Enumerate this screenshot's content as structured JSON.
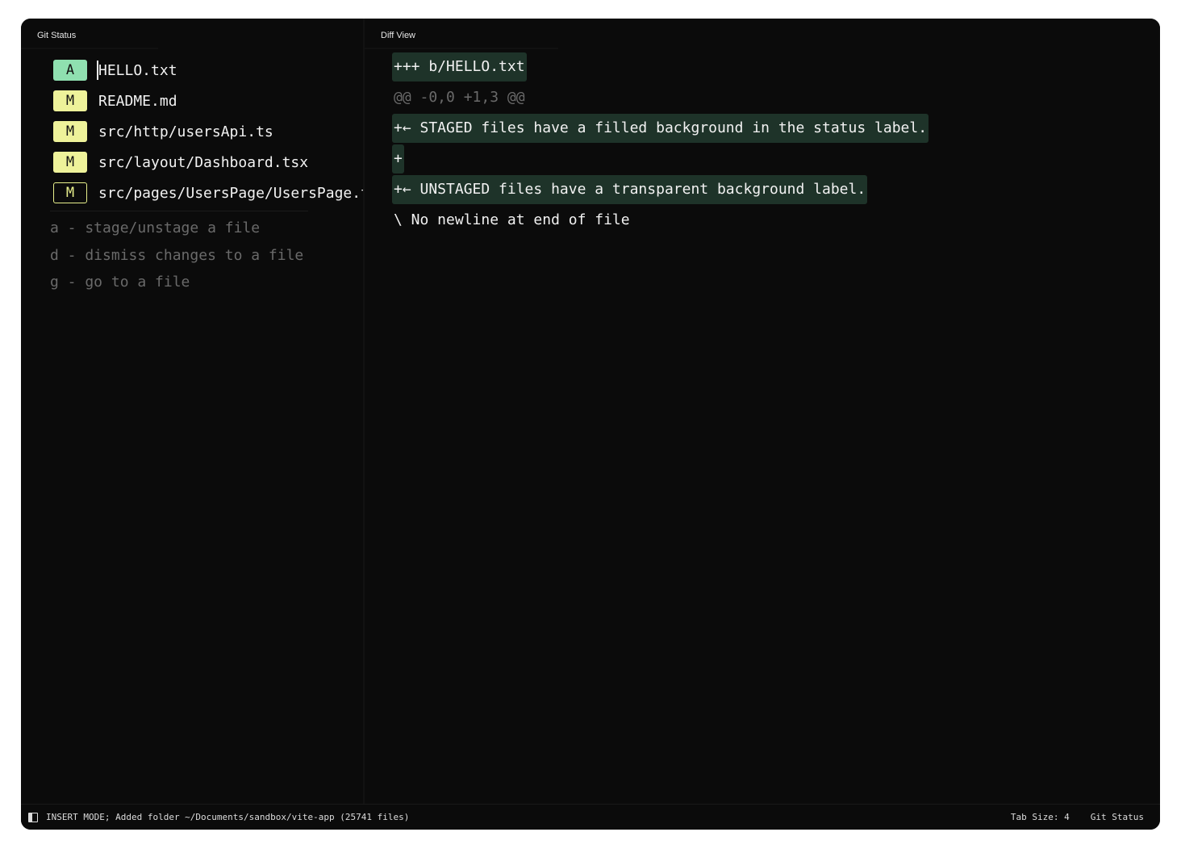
{
  "git_status": {
    "title": "Git Status",
    "files": [
      {
        "status": "A",
        "name": "HELLO.txt",
        "staged": true,
        "kind": "added"
      },
      {
        "status": "M",
        "name": "README.md",
        "staged": true,
        "kind": "modified"
      },
      {
        "status": "M",
        "name": "src/http/usersApi.ts",
        "staged": true,
        "kind": "modified"
      },
      {
        "status": "M",
        "name": "src/layout/Dashboard.tsx",
        "staged": true,
        "kind": "modified"
      },
      {
        "status": "M",
        "name": "src/pages/UsersPage/UsersPage.tsx",
        "staged": false,
        "kind": "modified"
      }
    ],
    "hints": [
      "a - stage/unstage a file",
      "d - dismiss changes to a file",
      "g - go to a file"
    ]
  },
  "diff_view": {
    "title": "Diff View",
    "lines": [
      {
        "text": "+++ b/HELLO.txt",
        "type": "add"
      },
      {
        "text": "@@ -0,0 +1,3 @@",
        "type": "hunk"
      },
      {
        "text": "+← STAGED files have a filled background in the status label.",
        "type": "add"
      },
      {
        "text": "+",
        "type": "add"
      },
      {
        "text": "+← UNSTAGED files have a transparent background label.",
        "type": "add"
      },
      {
        "text": "\\ No newline at end of file",
        "type": "context"
      }
    ]
  },
  "status_bar": {
    "message": "INSERT MODE; Added folder ~/Documents/sandbox/vite-app (25741 files)",
    "tab_size": "Tab Size: 4",
    "mode": "Git Status"
  },
  "colors": {
    "background": "#0b0b0b",
    "added_badge": "#8fe0b0",
    "modified_badge": "#eef29a",
    "diff_add_bg": "#1e3329",
    "muted_text": "#6a6a6a"
  },
  "icons": {
    "status_bar_panel": "sidebar-toggle-icon"
  }
}
